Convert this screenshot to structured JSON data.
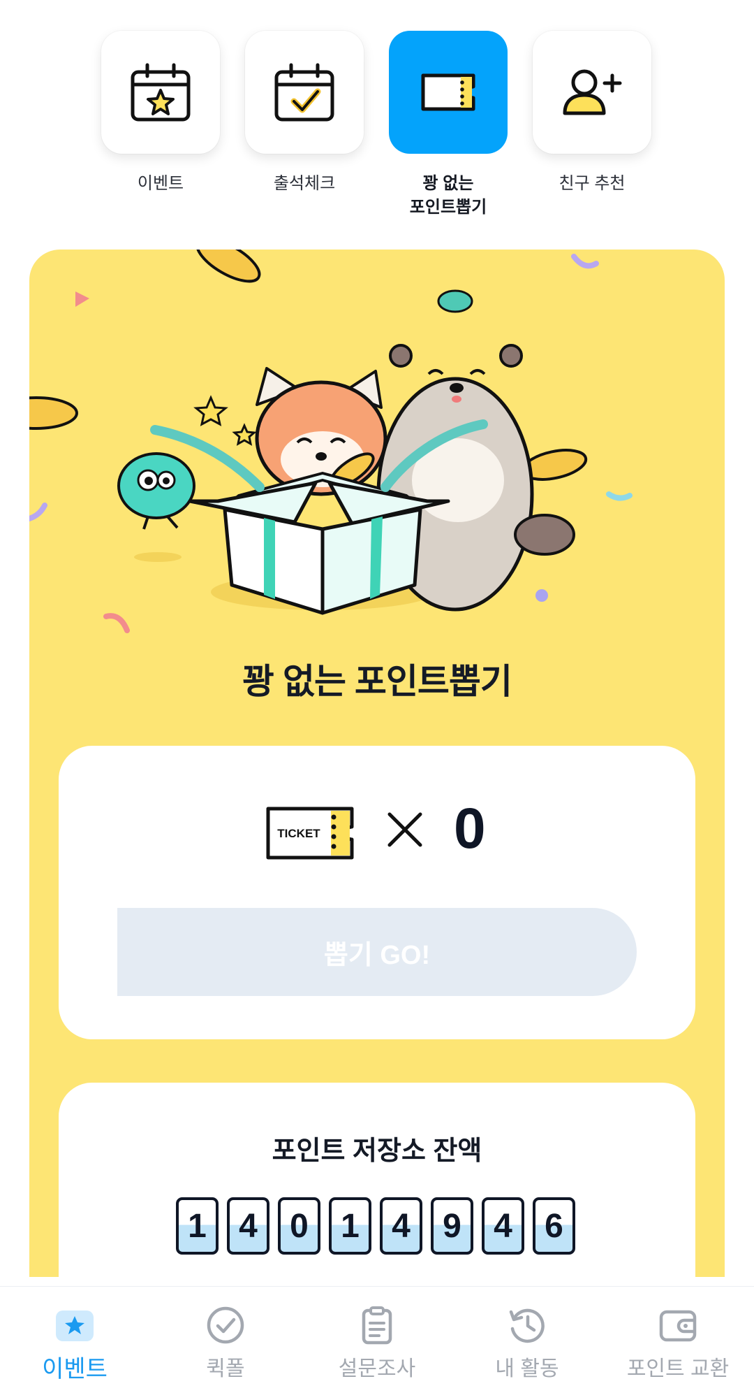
{
  "categories": [
    {
      "label": "이벤트",
      "icon": "calendar-star-icon",
      "active": false
    },
    {
      "label": "출석체크",
      "icon": "calendar-check-icon",
      "active": false
    },
    {
      "label": "꽝 없는\n포인트뽑기",
      "icon": "ticket-icon",
      "active": true
    },
    {
      "label": "친구 추천",
      "icon": "add-friend-icon",
      "active": false
    }
  ],
  "main": {
    "title": "꽝 없는 포인트뽑기",
    "ticket_label": "TICKET",
    "ticket_count": "0",
    "draw_button": "뽑기 GO!",
    "balance_title": "포인트 저장소 잔액",
    "balance_digits": [
      "1",
      "4",
      "0",
      "1",
      "4",
      "9",
      "4",
      "6"
    ]
  },
  "bottom_nav": [
    {
      "label": "이벤트",
      "icon": "star-ticket-icon",
      "active": true
    },
    {
      "label": "퀵폴",
      "icon": "check-circle-icon",
      "active": false
    },
    {
      "label": "설문조사",
      "icon": "clipboard-icon",
      "active": false
    },
    {
      "label": "내 활동",
      "icon": "history-icon",
      "active": false
    },
    {
      "label": "포인트 교환",
      "icon": "wallet-icon",
      "active": false
    }
  ],
  "colors": {
    "accent_blue": "#04a3fb",
    "card_yellow": "#fde574",
    "active_nav": "#1a9af0",
    "disabled_button": "#e4ebf3"
  }
}
